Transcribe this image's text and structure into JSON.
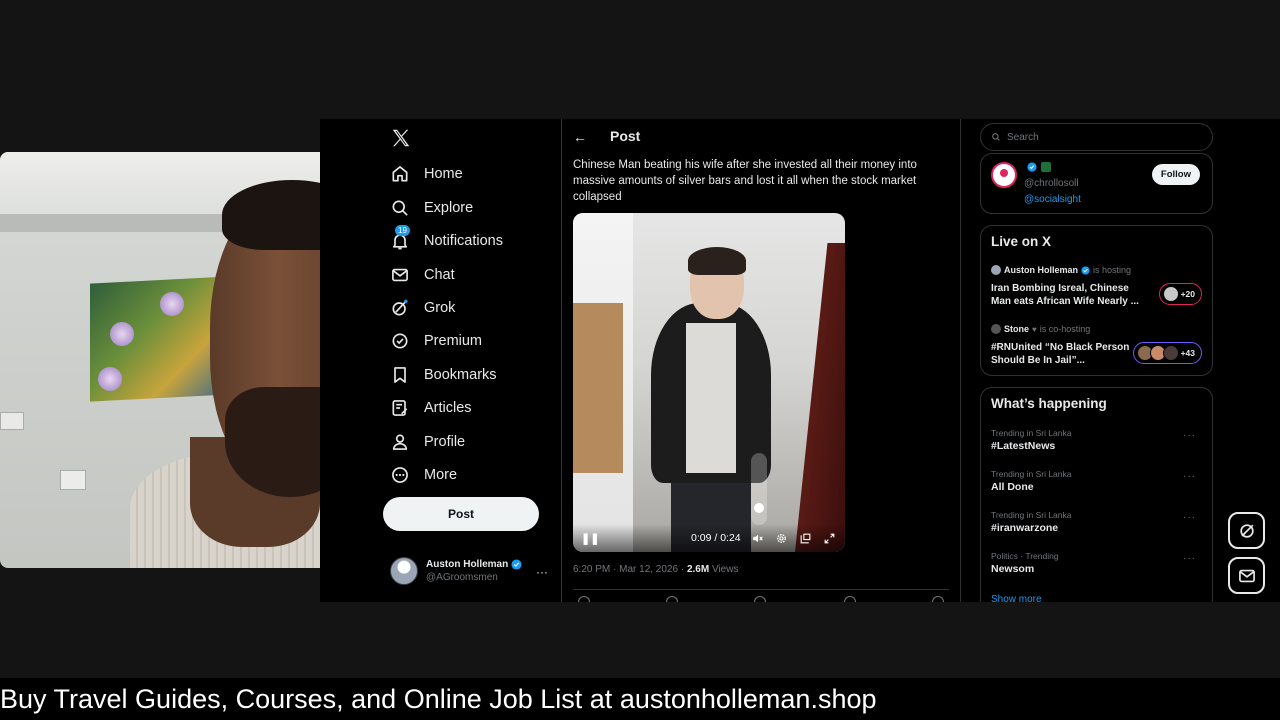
{
  "sidebar": {
    "items": [
      {
        "label": "Home",
        "icon": "home-icon"
      },
      {
        "label": "Explore",
        "icon": "search-icon"
      },
      {
        "label": "Notifications",
        "icon": "bell-icon",
        "badge": "19"
      },
      {
        "label": "Chat",
        "icon": "mail-icon"
      },
      {
        "label": "Grok",
        "icon": "grok-icon"
      },
      {
        "label": "Premium",
        "icon": "verified-icon"
      },
      {
        "label": "Bookmarks",
        "icon": "bookmark-icon"
      },
      {
        "label": "Articles",
        "icon": "article-icon"
      },
      {
        "label": "Profile",
        "icon": "person-icon"
      },
      {
        "label": "More",
        "icon": "more-circle-icon"
      }
    ],
    "post_label": "Post",
    "account": {
      "name": "Auston Holleman",
      "handle": "@AGroomsmen",
      "more": "···"
    }
  },
  "post": {
    "header": "Post",
    "text": "Chinese Man beating his wife after she invested all their money into massive amounts of silver bars and lost it all when the stock market collapsed",
    "video": {
      "time": "0:09 / 0:24",
      "progress": 0.375
    },
    "date": "6:20 PM · Mar 12, 2026 · ",
    "views_count": "2.6M",
    "views_label": " Views"
  },
  "right": {
    "search_placeholder": "Search",
    "who": {
      "handle": "@chrollosoll",
      "link": "@socialsight",
      "follow": "Follow"
    },
    "live": {
      "title": "Live on X",
      "spaces": [
        {
          "host": "Auston Holleman",
          "role": " is hosting",
          "title": "Iran Bombing Isreal, Chinese Man eats African Wife Nearly ...",
          "count": "+20"
        },
        {
          "host": "Stone",
          "role": " is co-hosting",
          "title": "#RNUnited “No Black Person Should Be In Jail”...",
          "count": "+43"
        }
      ]
    },
    "happening": {
      "title": "What’s happening",
      "trends": [
        {
          "category": "Trending in Sri Lanka",
          "name": "#LatestNews"
        },
        {
          "category": "Trending in Sri Lanka",
          "name": "All Done"
        },
        {
          "category": "Trending in Sri Lanka",
          "name": "#iranwarzone"
        },
        {
          "category": "Politics · Trending",
          "name": "Newsom"
        }
      ],
      "show_more": "Show more"
    }
  },
  "banner": "Buy Travel Guides, Courses, and Online Job List at austonholleman.shop",
  "colors": {
    "accent": "#1d9bf0",
    "background": "#000000",
    "page": "#141414"
  }
}
